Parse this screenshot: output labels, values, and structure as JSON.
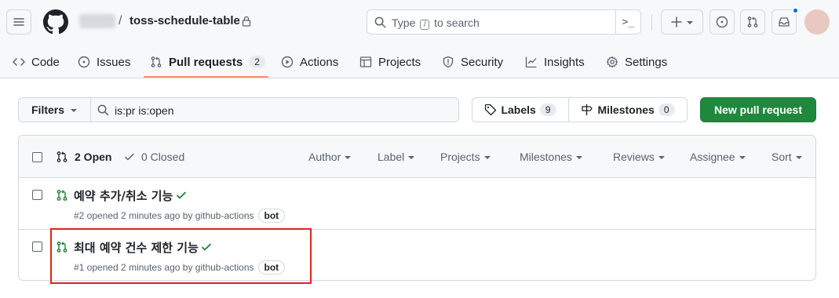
{
  "header": {
    "repo_name": "toss-schedule-table",
    "crumb_separator": "/",
    "search": {
      "prefix": "Type",
      "key": "/",
      "suffix": "to search",
      "command_glyph": ">_"
    }
  },
  "nav": {
    "items": [
      {
        "label": "Code",
        "icon": "code-icon"
      },
      {
        "label": "Issues",
        "icon": "issue-opened-icon"
      },
      {
        "label": "Pull requests",
        "icon": "git-pull-request-icon",
        "count": "2",
        "active": true
      },
      {
        "label": "Actions",
        "icon": "play-icon"
      },
      {
        "label": "Projects",
        "icon": "table-icon"
      },
      {
        "label": "Security",
        "icon": "shield-icon"
      },
      {
        "label": "Insights",
        "icon": "graph-icon"
      },
      {
        "label": "Settings",
        "icon": "gear-icon"
      }
    ],
    "underline_color": "#fd8c73"
  },
  "toolbar": {
    "filters_label": "Filters",
    "search_value": "is:pr is:open",
    "labels_label": "Labels",
    "labels_count": "9",
    "milestones_label": "Milestones",
    "milestones_count": "0",
    "new_pr_label": "New pull request",
    "new_pr_color": "#1f883d"
  },
  "list": {
    "open_label": "2 Open",
    "closed_label": "0 Closed",
    "filters": [
      "Author",
      "Label",
      "Projects",
      "Milestones",
      "Reviews",
      "Assignee",
      "Sort"
    ],
    "rows": [
      {
        "title": "예약 추가/취소 기능",
        "meta": "#2 opened 2 minutes ago by github-actions",
        "badge": "bot",
        "status": "success"
      },
      {
        "title": "최대 예약 건수 제한 기능",
        "meta": "#1 opened 2 minutes ago by github-actions",
        "badge": "bot",
        "status": "success",
        "highlighted": true
      }
    ]
  },
  "colors": {
    "open_green": "#1a7f37",
    "highlight_red": "#d9261c",
    "notification_blue": "#0969da"
  }
}
